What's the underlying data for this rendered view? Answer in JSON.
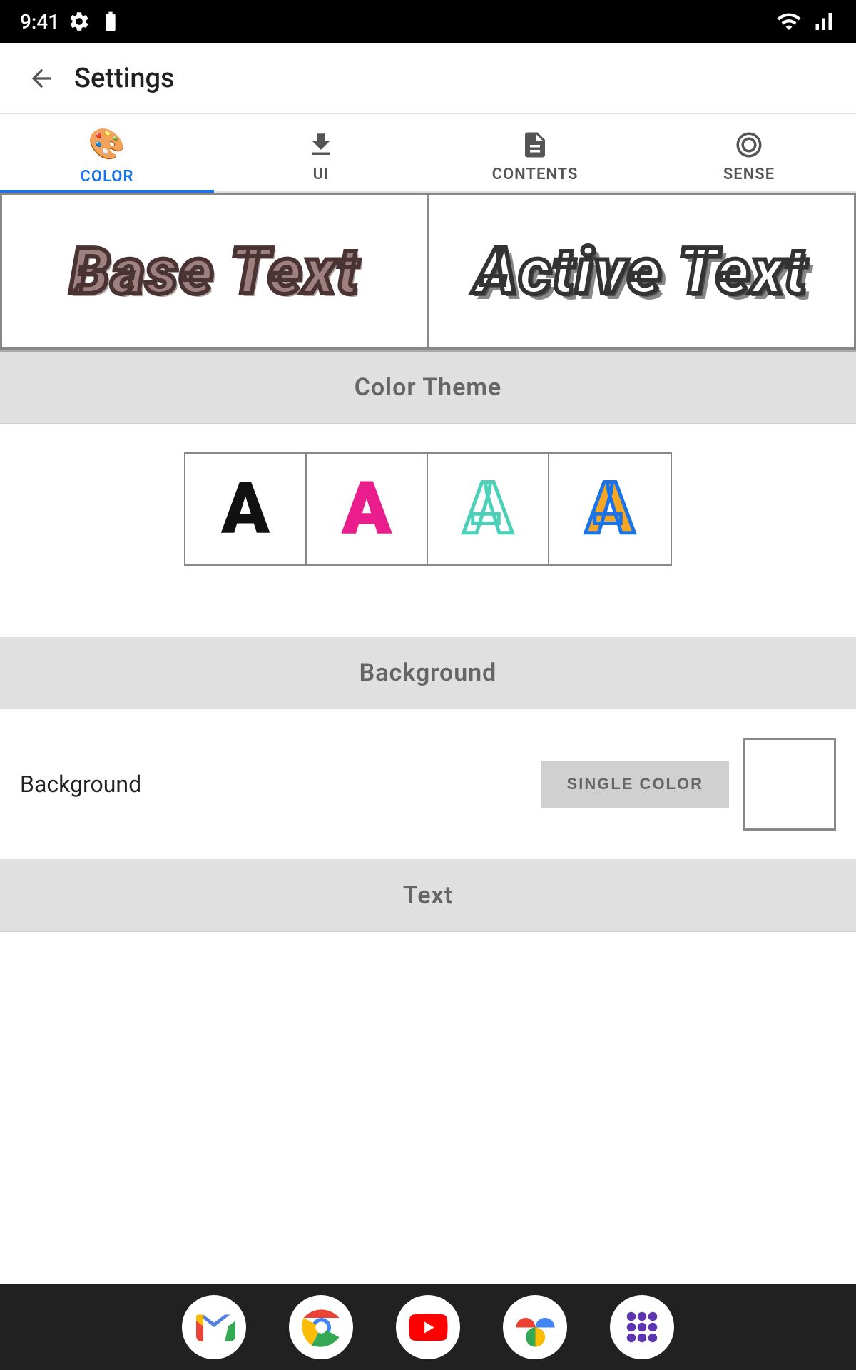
{
  "statusBar": {
    "time": "9:41",
    "icons": [
      "settings",
      "battery"
    ]
  },
  "header": {
    "backLabel": "←",
    "title": "Settings"
  },
  "tabs": [
    {
      "id": "color",
      "label": "COLOR",
      "active": true
    },
    {
      "id": "ui",
      "label": "UI",
      "active": false
    },
    {
      "id": "contents",
      "label": "CONTENTS",
      "active": false
    },
    {
      "id": "sense",
      "label": "SENSE",
      "active": false
    }
  ],
  "preview": {
    "baseText": "Base Text",
    "activeText": "Active Text"
  },
  "sections": {
    "colorTheme": {
      "label": "Color Theme"
    },
    "background": {
      "label": "Background",
      "rowLabel": "Background",
      "singleColorLabel": "SINGLE COLOR"
    },
    "text": {
      "label": "Text"
    }
  },
  "bottomNav": {
    "apps": [
      "gmail",
      "chrome",
      "youtube",
      "photos",
      "launcher"
    ]
  },
  "colors": {
    "activeTab": "#1a73e8",
    "sectionHeader": "#e0e0e0"
  }
}
